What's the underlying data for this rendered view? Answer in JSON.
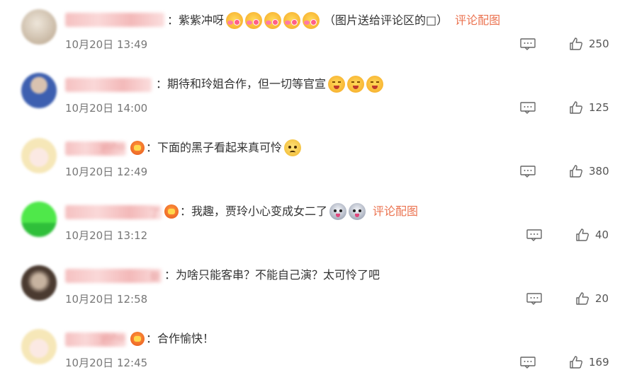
{
  "comments": [
    {
      "username_blurred": "",
      "badge": false,
      "text": "：紫紫冲呀",
      "emojis": [
        "kiss-emoji",
        "kiss-emoji",
        "kiss-emoji",
        "kiss-emoji",
        "kiss-emoji"
      ],
      "suffix": "（图片送给评论区的□）",
      "link": "评论配图",
      "date": "10月20日 13:49",
      "likes": "250",
      "avatar_colors": [
        "#e6ddd0",
        "#b8a48c"
      ]
    },
    {
      "username_blurred": "",
      "badge": false,
      "text": "：期待和玲姐合作，但一切等官宣",
      "emojis": [
        "blush-emoji",
        "blush-emoji",
        "blush-emoji"
      ],
      "suffix": "",
      "link": "",
      "date": "10月20日 14:00",
      "likes": "125",
      "avatar_colors": [
        "#3d5fb0",
        "#d9c2b0"
      ]
    },
    {
      "username_blurred": "yoho",
      "badge": true,
      "text": "：下面的黑子看起来真可怜",
      "emojis": [
        "sad-emoji"
      ],
      "suffix": "",
      "link": "",
      "date": "10月20日 12:49",
      "likes": "380",
      "avatar_colors": [
        "#f6e7b8",
        "#f3c9c9"
      ]
    },
    {
      "username_blurred": "了",
      "badge": true,
      "text": "：我趣，贾玲小心变成女二了",
      "emojis": [
        "husky-emoji",
        "husky-emoji"
      ],
      "suffix": "",
      "link": "评论配图",
      "date": "10月20日 13:12",
      "likes": "40",
      "avatar_colors": [
        "#4fe84a",
        "#d23b3b"
      ]
    },
    {
      "username_blurred": "曼",
      "badge": false,
      "text": "：为啥只能客串？不能自己演？太可怜了吧",
      "emojis": [],
      "suffix": "",
      "link": "",
      "date": "10月20日 12:58",
      "likes": "20",
      "avatar_colors": [
        "#4a3a30",
        "#c7b3a0"
      ]
    },
    {
      "username_blurred": "yoho",
      "badge": true,
      "text": "：合作愉快！",
      "emojis": [],
      "suffix": "",
      "link": "",
      "date": "10月20日 12:45",
      "likes": "169",
      "avatar_colors": [
        "#f6e7b8",
        "#f3c9c9"
      ]
    }
  ],
  "colors": {
    "link": "#eb7350",
    "date": "#777777",
    "text": "#333333"
  },
  "icons": {
    "reply": "comment-icon",
    "like": "thumbs-up-icon"
  }
}
